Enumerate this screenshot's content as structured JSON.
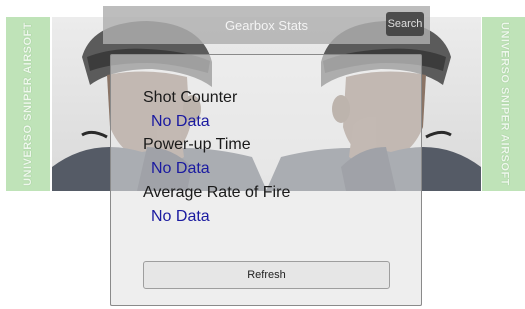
{
  "app_bar": {
    "title": "Gearbox Stats",
    "search_label": "Search"
  },
  "banners": {
    "left_text": "UNIVERSO SNIPER AIRSOFT",
    "right_text": "UNIVERSO SNIPER AIRSOFT"
  },
  "stats": [
    {
      "label": "Shot Counter",
      "value": "No Data"
    },
    {
      "label": "Power-up Time",
      "value": "No Data"
    },
    {
      "label": "Average Rate of Fire",
      "value": "No Data"
    }
  ],
  "refresh_label": "Refresh",
  "colors": {
    "value_text": "#1a1aa0",
    "banner_bg": "#bfe3b8"
  }
}
